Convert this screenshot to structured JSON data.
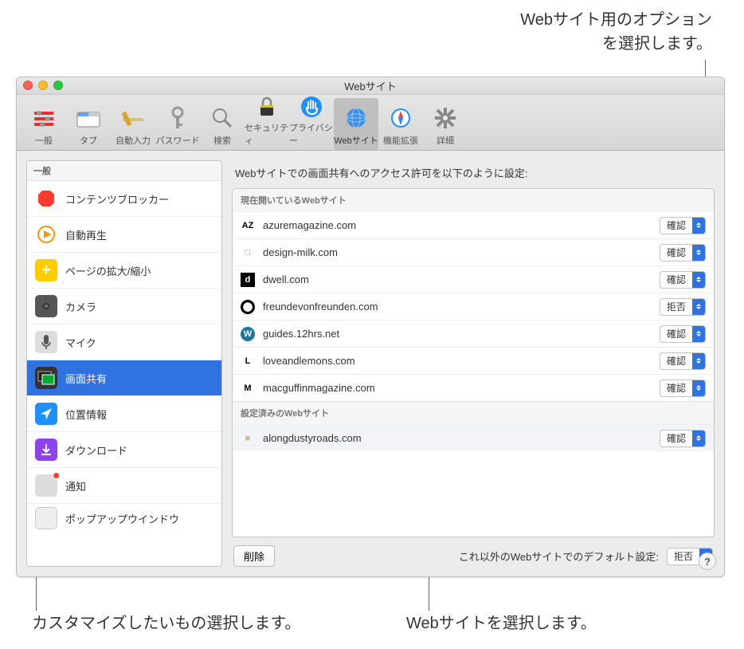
{
  "annotations": {
    "top": "Webサイト用のオプション\nを選択します。",
    "bottom_left": "カスタマイズしたいもの選択します。",
    "bottom_right": "Webサイトを選択します。"
  },
  "window": {
    "title": "Webサイト"
  },
  "toolbar": {
    "items": [
      {
        "label": "一般"
      },
      {
        "label": "タブ"
      },
      {
        "label": "自動入力"
      },
      {
        "label": "パスワード"
      },
      {
        "label": "検索"
      },
      {
        "label": "セキュリティ"
      },
      {
        "label": "プライバシー"
      },
      {
        "label": "Webサイト"
      },
      {
        "label": "機能拡張"
      },
      {
        "label": "詳細"
      }
    ]
  },
  "sidebar": {
    "header": "一般",
    "items": [
      {
        "label": "コンテンツブロッカー"
      },
      {
        "label": "自動再生"
      },
      {
        "label": "ページの拡大/縮小"
      },
      {
        "label": "カメラ"
      },
      {
        "label": "マイク"
      },
      {
        "label": "画面共有"
      },
      {
        "label": "位置情報"
      },
      {
        "label": "ダウンロード"
      },
      {
        "label": "通知"
      },
      {
        "label": "ポップアップウインドウ"
      }
    ]
  },
  "content": {
    "header": "Webサイトでの画面共有へのアクセス許可を以下のように設定:",
    "section_open": "現在開いているWebサイト",
    "section_configured": "設定済みのWebサイト",
    "remove_label": "削除",
    "default_label": "これ以外のWebサイトでのデフォルト設定:",
    "default_value": "拒否",
    "open_sites": [
      {
        "name": "azuremagazine.com",
        "value": "確認",
        "icon": "AZ",
        "fg": "#000"
      },
      {
        "name": "design-milk.com",
        "value": "確認",
        "icon": "□",
        "fg": "#888"
      },
      {
        "name": "dwell.com",
        "value": "確認",
        "icon": "d",
        "bg": "#000",
        "fg": "#fff"
      },
      {
        "name": "freundevonfreunden.com",
        "value": "拒否",
        "icon": "⬤",
        "bg": "#000",
        "fg": "#fff",
        "round": true
      },
      {
        "name": "guides.12hrs.net",
        "value": "確認",
        "icon": "W",
        "bg": "#21759b",
        "fg": "#fff",
        "round": true
      },
      {
        "name": "loveandlemons.com",
        "value": "確認",
        "icon": "L",
        "fg": "#000"
      },
      {
        "name": "macguffinmagazine.com",
        "value": "確認",
        "icon": "M",
        "fg": "#000"
      }
    ],
    "configured_sites": [
      {
        "name": "alongdustyroads.com",
        "value": "確認",
        "icon": "■",
        "fg": "#c9b8a0"
      }
    ]
  }
}
